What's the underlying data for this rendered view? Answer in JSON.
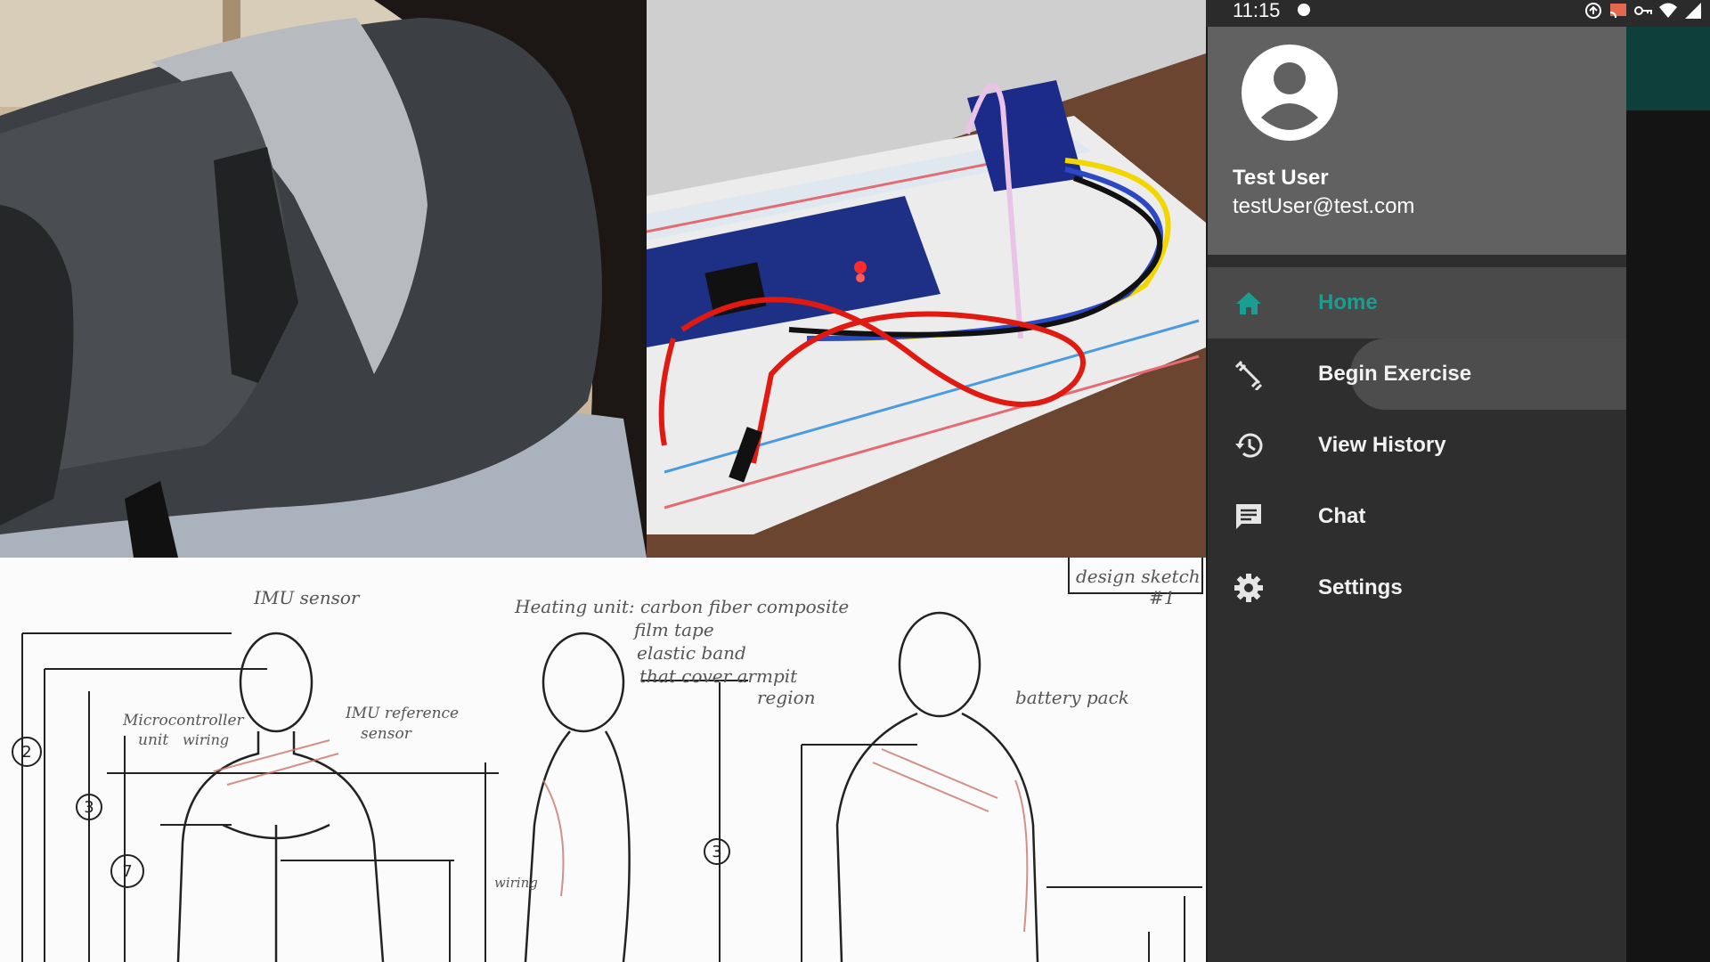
{
  "status_bar": {
    "time": "11:15",
    "icons": [
      "sync-icon",
      "cast-icon",
      "vpn-key-icon",
      "wifi-icon",
      "signal-icon"
    ]
  },
  "drawer": {
    "user": {
      "name": "Test User",
      "email": "testUser@test.com",
      "avatar_icon": "account-circle-icon"
    },
    "items": [
      {
        "label": "Home",
        "icon": "home-icon",
        "selected": true
      },
      {
        "label": "Begin Exercise",
        "icon": "fitness-icon",
        "selected": false
      },
      {
        "label": "View History",
        "icon": "history-icon",
        "selected": false
      },
      {
        "label": "Chat",
        "icon": "chat-icon",
        "selected": false
      },
      {
        "label": "Settings",
        "icon": "gear-icon",
        "selected": false
      }
    ]
  },
  "sketch": {
    "annotations": [
      "IMU sensor",
      "Heating unit: carbon fiber composite",
      "film tape",
      "elastic band",
      "that cover armpit",
      "region",
      "design sketch",
      "#1",
      "Microcontroller",
      "unit",
      "wiring",
      "IMU reference",
      "sensor",
      "battery pack",
      "wiring"
    ],
    "numbers": [
      "2",
      "3",
      "7",
      "3"
    ]
  },
  "colors": {
    "accent": "#1b9e92",
    "drawer_bg": "#2e2e2e",
    "header_bg": "#616161",
    "selected_bg": "#4a4a4a",
    "toolbar": "#0f3f3b"
  }
}
